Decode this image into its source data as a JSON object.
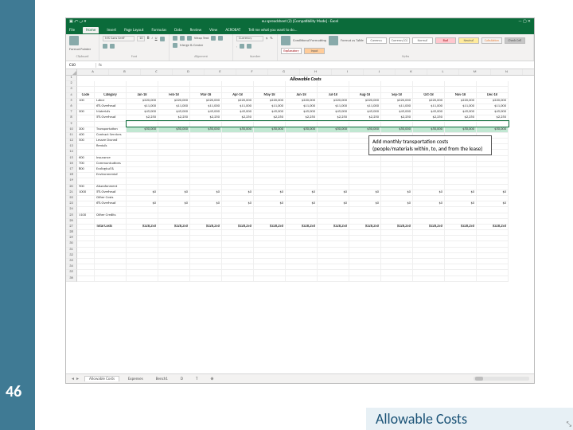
{
  "slide_number": "46",
  "footer_title": "Allowable Costs",
  "excel": {
    "window_title": "eu spreadsheet (2) [Compatibility Mode] - Excel",
    "tabs": [
      "File",
      "Home",
      "Insert",
      "Page Layout",
      "Formulas",
      "Data",
      "Review",
      "View",
      "ACROBAT",
      "Tell me what you want to do..."
    ],
    "active_tab": "Home",
    "ribbon": {
      "clipboard": "Clipboard",
      "paste": "Paste",
      "format_painter": "Format Painter",
      "font_name": "MS Sans Serif",
      "font_size": "10",
      "font_group": "Font",
      "alignment_group": "Alignment",
      "wrap_text": "Wrap Text",
      "merge_center": "Merge & Center",
      "number_group": "Number",
      "number_format": "Currency",
      "cond_fmt": "Conditional Formatting",
      "fmt_table": "Format as Table",
      "styles_group": "Styles",
      "style_currency": "Currency",
      "style_currency0": "Currency [0]",
      "style_normal": "Normal",
      "style_neutral": "Neutral",
      "style_calc": "Calculation",
      "style_check": "Check Cell",
      "style_bad": "Bad",
      "style_expl": "Explanatory",
      "style_input": "Input"
    },
    "formula_bar": {
      "namebox": "C10",
      "fx_label": "fx",
      "formula": ""
    },
    "columns": [
      "A",
      "B",
      "C",
      "D",
      "E",
      "F",
      "G",
      "H",
      "I",
      "J",
      "K",
      "L",
      "M",
      "N"
    ],
    "row_numbers": [
      "1",
      "2",
      "3",
      "4",
      "5",
      "6",
      "7",
      "8",
      "9",
      "10",
      "11",
      "12",
      "13",
      "14",
      "15",
      "16",
      "17",
      "18",
      "19",
      "20",
      "21",
      "22",
      "23",
      "24",
      "25",
      "26",
      "27",
      "28",
      "29",
      "30",
      "31",
      "32",
      "33",
      "34",
      "35",
      "36"
    ],
    "title": "Allowable Costs",
    "header_row": [
      "Code",
      "Category",
      "Jan-18",
      "Feb-18",
      "Mar-18",
      "Apr-18",
      "May-18",
      "Jun-18",
      "Jul-18",
      "Aug-18",
      "Sep-18",
      "Oct-18",
      "Nov-18",
      "Dec-18"
    ],
    "rows": [
      {
        "code": "100",
        "cat": "Labor",
        "v": [
          "$220,000",
          "$220,000",
          "$220,000",
          "$220,000",
          "$220,000",
          "$220,000",
          "$220,000",
          "$220,000",
          "$220,000",
          "$220,000",
          "$220,000",
          "$220,000"
        ]
      },
      {
        "code": "",
        "cat": "     6% Overhead",
        "v": [
          "$11,000",
          "$11,000",
          "$11,000",
          "$11,000",
          "$11,000",
          "$11,000",
          "$11,000",
          "$11,000",
          "$11,000",
          "$11,000",
          "$11,000",
          "$11,000"
        ]
      },
      {
        "code": "200",
        "cat": "Materials",
        "v": [
          "$45,000",
          "$45,000",
          "$45,000",
          "$45,000",
          "$45,000",
          "$45,000",
          "$45,000",
          "$45,000",
          "$45,000",
          "$45,000",
          "$45,000",
          "$45,000"
        ]
      },
      {
        "code": "",
        "cat": "     5% Overhead",
        "v": [
          "$2,250",
          "$2,250",
          "$2,250",
          "$2,250",
          "$2,250",
          "$2,250",
          "$2,250",
          "$2,250",
          "$2,250",
          "$2,250",
          "$2,250",
          "$2,250"
        ]
      },
      {
        "code": "",
        "cat": "",
        "v": [
          "",
          "",
          "",
          "",
          "",
          "",
          "",
          "",
          "",
          "",
          "",
          ""
        ]
      },
      {
        "code": "300",
        "cat": "Transportation",
        "v": [
          "$50,000",
          "$50,000",
          "$50,000",
          "$50,000",
          "$50,000",
          "$50,000",
          "$50,000",
          "$50,000",
          "$50,000",
          "$50,000",
          "$50,000",
          "$50,000"
        ],
        "highlight": true
      },
      {
        "code": "400",
        "cat": "Contract Services",
        "v": [
          "",
          "",
          "",
          "",
          "",
          "",
          "",
          "",
          "",
          "",
          "",
          ""
        ]
      },
      {
        "code": "500",
        "cat": "Lessee Owned",
        "v": [
          "",
          "",
          "",
          "",
          "",
          "",
          "",
          "",
          "",
          "",
          "",
          ""
        ]
      },
      {
        "code": "",
        "cat": "     Rentals",
        "v": [
          "",
          "",
          "",
          "",
          "",
          "",
          "",
          "",
          "",
          "",
          "",
          ""
        ]
      },
      {
        "code": "",
        "cat": "",
        "v": [
          "",
          "",
          "",
          "",
          "",
          "",
          "",
          "",
          "",
          "",
          "",
          ""
        ]
      },
      {
        "code": "600",
        "cat": "Insurance",
        "v": [
          "",
          "",
          "",
          "",
          "",
          "",
          "",
          "",
          "",
          "",
          "",
          ""
        ]
      },
      {
        "code": "700",
        "cat": "Communications",
        "v": [
          "",
          "",
          "",
          "",
          "",
          "",
          "",
          "",
          "",
          "",
          "",
          ""
        ]
      },
      {
        "code": "800",
        "cat": "Ecological &",
        "v": [
          "",
          "",
          "",
          "",
          "",
          "",
          "",
          "",
          "",
          "",
          "",
          ""
        ]
      },
      {
        "code": "",
        "cat": "     Environmental",
        "v": [
          "",
          "",
          "",
          "",
          "",
          "",
          "",
          "",
          "",
          "",
          "",
          ""
        ]
      },
      {
        "code": "",
        "cat": "",
        "v": [
          "",
          "",
          "",
          "",
          "",
          "",
          "",
          "",
          "",
          "",
          "",
          ""
        ]
      },
      {
        "code": "900",
        "cat": "Abandonment",
        "v": [
          "",
          "",
          "",
          "",
          "",
          "",
          "",
          "",
          "",
          "",
          "",
          ""
        ]
      },
      {
        "code": "1000",
        "cat": "     5% Overhead",
        "v": [
          "$0",
          "$0",
          "$0",
          "$0",
          "$0",
          "$0",
          "$0",
          "$0",
          "$0",
          "$0",
          "$0",
          "$0"
        ]
      },
      {
        "code": "",
        "cat": "Other Costs",
        "v": [
          "",
          "",
          "",
          "",
          "",
          "",
          "",
          "",
          "",
          "",
          "",
          ""
        ]
      },
      {
        "code": "",
        "cat": "     6% Overhead",
        "v": [
          "$0",
          "$0",
          "$0",
          "$0",
          "$0",
          "$0",
          "$0",
          "$0",
          "$0",
          "$0",
          "$0",
          "$0"
        ]
      },
      {
        "code": "",
        "cat": "",
        "v": [
          "",
          "",
          "",
          "",
          "",
          "",
          "",
          "",
          "",
          "",
          "",
          ""
        ]
      },
      {
        "code": "1100",
        "cat": "Other Credits",
        "v": [
          "",
          "",
          "",
          "",
          "",
          "",
          "",
          "",
          "",
          "",
          "",
          ""
        ]
      },
      {
        "code": "",
        "cat": "",
        "v": [
          "",
          "",
          "",
          "",
          "",
          "",
          "",
          "",
          "",
          "",
          "",
          ""
        ]
      },
      {
        "code": "",
        "cat": "Total Costs",
        "v": [
          "$328,250",
          "$328,250",
          "$328,250",
          "$328,250",
          "$328,250",
          "$328,250",
          "$328,250",
          "$328,250",
          "$328,250",
          "$328,250",
          "$328,250",
          "$328,250"
        ],
        "total": true
      }
    ],
    "callout": "Add monthly transportation costs (people/materials within, to, and from the lease)",
    "sheet_tabs": {
      "nav": "◄ ►",
      "active": "Allowable Costs",
      "others": [
        "Expenses",
        "Bench1",
        "D",
        "T"
      ],
      "plus": "⊕"
    }
  },
  "chart_data": {
    "type": "table",
    "title": "Allowable Costs",
    "categories": [
      "Jan-18",
      "Feb-18",
      "Mar-18",
      "Apr-18",
      "May-18",
      "Jun-18",
      "Jul-18",
      "Aug-18",
      "Sep-18",
      "Oct-18",
      "Nov-18",
      "Dec-18"
    ],
    "series": [
      {
        "name": "Labor (100)",
        "values": [
          220000,
          220000,
          220000,
          220000,
          220000,
          220000,
          220000,
          220000,
          220000,
          220000,
          220000,
          220000
        ]
      },
      {
        "name": "Labor 6% Overhead",
        "values": [
          11000,
          11000,
          11000,
          11000,
          11000,
          11000,
          11000,
          11000,
          11000,
          11000,
          11000,
          11000
        ]
      },
      {
        "name": "Materials (200)",
        "values": [
          45000,
          45000,
          45000,
          45000,
          45000,
          45000,
          45000,
          45000,
          45000,
          45000,
          45000,
          45000
        ]
      },
      {
        "name": "Materials 5% Overhead",
        "values": [
          2250,
          2250,
          2250,
          2250,
          2250,
          2250,
          2250,
          2250,
          2250,
          2250,
          2250,
          2250
        ]
      },
      {
        "name": "Transportation (300)",
        "values": [
          50000,
          50000,
          50000,
          50000,
          50000,
          50000,
          50000,
          50000,
          50000,
          50000,
          50000,
          50000
        ]
      },
      {
        "name": "5% Overhead (1000)",
        "values": [
          0,
          0,
          0,
          0,
          0,
          0,
          0,
          0,
          0,
          0,
          0,
          0
        ]
      },
      {
        "name": "Other 6% Overhead",
        "values": [
          0,
          0,
          0,
          0,
          0,
          0,
          0,
          0,
          0,
          0,
          0,
          0
        ]
      },
      {
        "name": "Total Costs",
        "values": [
          328250,
          328250,
          328250,
          328250,
          328250,
          328250,
          328250,
          328250,
          328250,
          328250,
          328250,
          328250
        ]
      }
    ]
  }
}
